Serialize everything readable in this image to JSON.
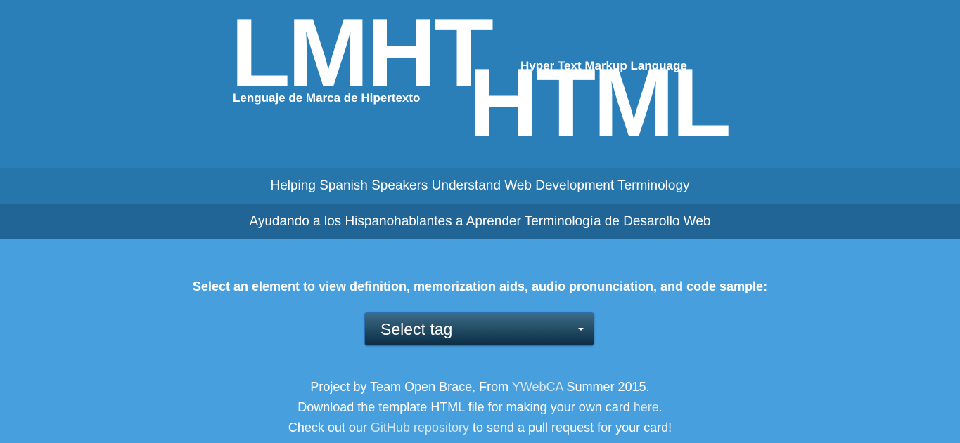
{
  "header": {
    "logo_top": "LMHT",
    "logo_bottom": "HTML",
    "subtitle_es": "Lenguaje de Marca de Hipertexto",
    "subtitle_en": "Hyper Text Markup Language"
  },
  "bands": {
    "english": "Helping Spanish Speakers Understand Web Development Terminology",
    "spanish": "Ayudando a los Hispanohablantes a Aprender Terminología de Desarollo Web"
  },
  "main": {
    "prompt": "Select an element to view definition, memorization aids, audio pronunciation, and code sample:",
    "select_value": "Select tag"
  },
  "footer": {
    "line1_pre": "Project by Team Open Brace, From ",
    "line1_link": "YWebCA",
    "line1_post": " Summer 2015.",
    "line2_pre": "Download the template HTML file for making your own card ",
    "line2_link": "here",
    "line2_post": ".",
    "line3_pre": "Check out our ",
    "line3_link": "GitHub repository",
    "line3_post": " to send a pull request for your card!"
  },
  "colors": {
    "header_bg": "#2a7fb8",
    "band1_bg": "#2675ab",
    "band2_bg": "#206596",
    "page_bg": "#489fde",
    "link": "#d8e6ef"
  }
}
